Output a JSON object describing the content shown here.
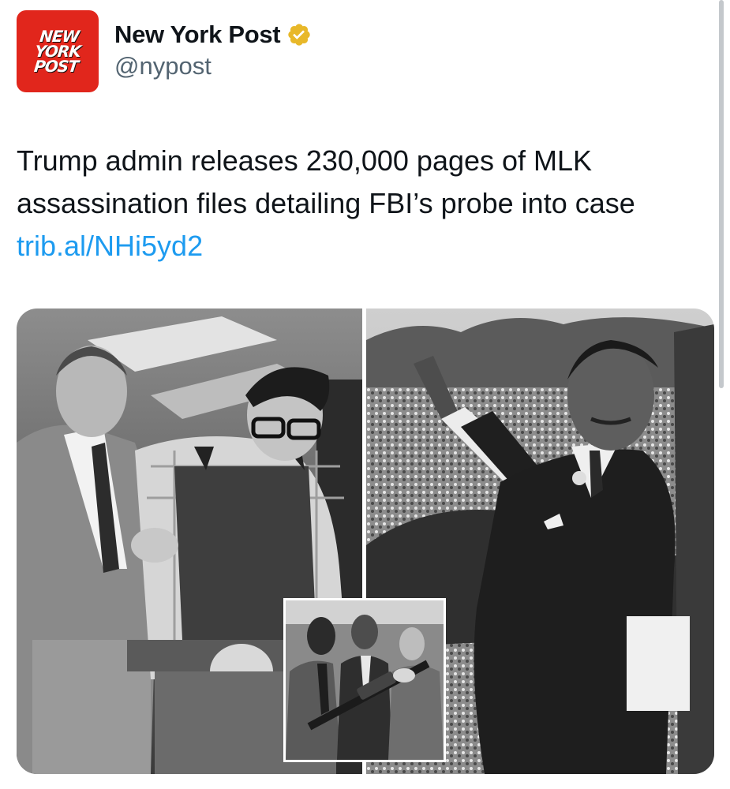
{
  "tweet": {
    "author": {
      "name": "New York Post",
      "handle": "@nypost",
      "verified": true,
      "avatar_logo_text": "NEW\nYORK\nPOST",
      "brand_color": "#e1261c",
      "verified_badge_color": "#e8b829"
    },
    "text_lines": [
      "Trump admin releases 230,000 pages of MLK",
      "assassination files detailing FBI’s probe into case"
    ],
    "link": "trib.al/NHi5yd2",
    "link_color": "#1d9bf0",
    "media": {
      "count": 2,
      "style": "black-and-white",
      "has_inset_photo": true
    }
  },
  "icons": {
    "verified": "verified-badge-icon"
  }
}
